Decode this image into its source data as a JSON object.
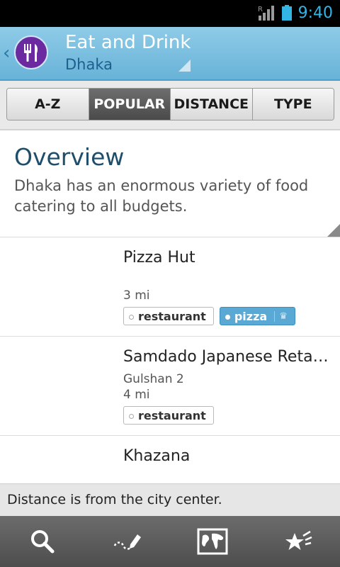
{
  "status": {
    "time": "9:40",
    "signal_label": "R"
  },
  "header": {
    "title": "Eat and Drink",
    "subtitle": "Dhaka",
    "logo_icon": "fork-knife-icon",
    "accent_color": "#6b2aa0"
  },
  "tabs": [
    {
      "label": "A-Z",
      "active": false
    },
    {
      "label": "POPULAR",
      "active": true
    },
    {
      "label": "DISTANCE",
      "active": false
    },
    {
      "label": "TYPE",
      "active": false
    }
  ],
  "overview": {
    "heading": "Overview",
    "text": "Dhaka has an enormous variety of food catering to all budgets."
  },
  "listings": [
    {
      "name": "Pizza Hut",
      "area": "",
      "distance": "3 mi",
      "tags": [
        {
          "label": "restaurant",
          "style": "plain"
        },
        {
          "label": "pizza",
          "style": "blue"
        }
      ]
    },
    {
      "name": "Samdado Japanese Reta…",
      "area": "Gulshan 2",
      "distance": "4 mi",
      "tags": [
        {
          "label": "restaurant",
          "style": "plain"
        }
      ]
    },
    {
      "name": "Khazana",
      "area": "",
      "distance": "",
      "tags": []
    }
  ],
  "footnote": "Distance is from the city center.",
  "bottom_nav": [
    {
      "icon": "search-icon"
    },
    {
      "icon": "edit-route-icon"
    },
    {
      "icon": "map-icon"
    },
    {
      "icon": "favorites-icon"
    }
  ]
}
